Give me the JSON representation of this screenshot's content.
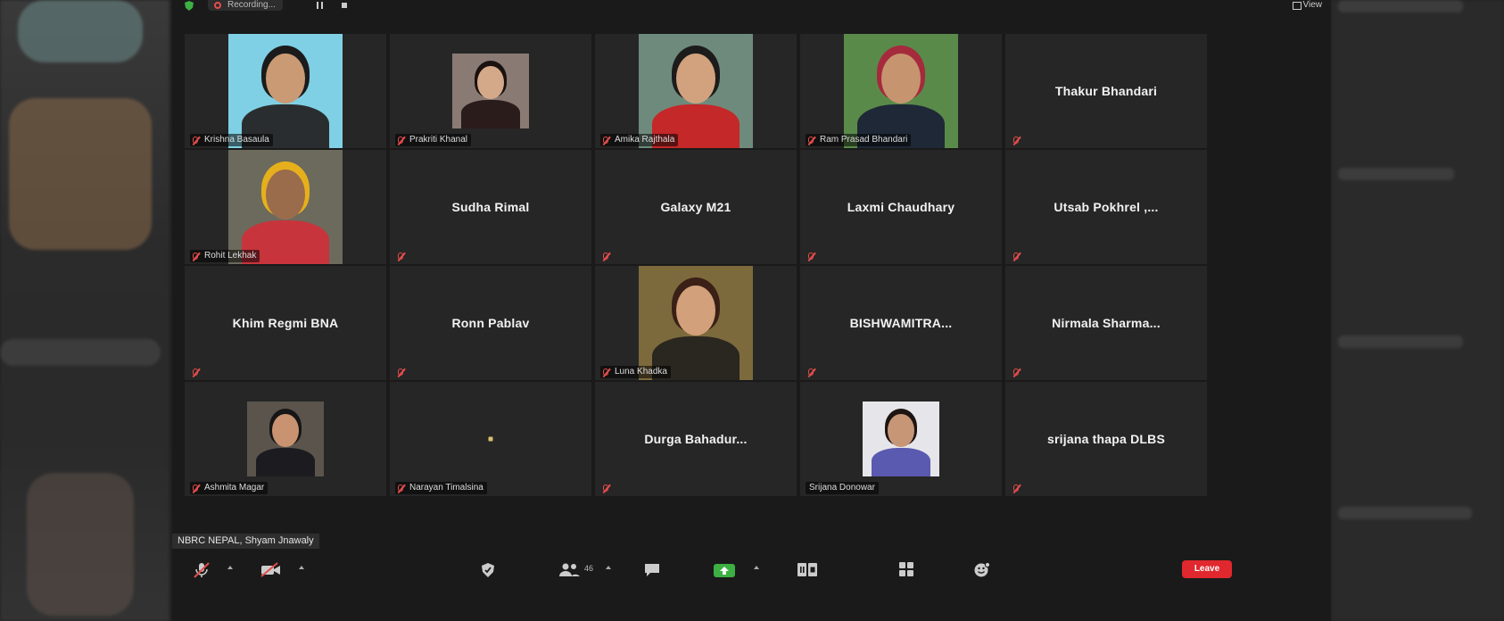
{
  "topbar": {
    "recording_label": "Recording...",
    "view_label": "View"
  },
  "tiles": [
    {
      "name": "Krishna Basaula",
      "display": "video",
      "muted": true,
      "photo_bg": "#7fd0e4",
      "skin": "#c99a74",
      "hair": "#1b1b1b",
      "cloth": "#2a2d2f"
    },
    {
      "name": "Prakriti Khanal",
      "display": "video",
      "muted": true,
      "photo_bg": "#8a7a74",
      "skin": "#d4a98a",
      "hair": "#1a1210",
      "cloth": "#2a1c1a"
    },
    {
      "name": "Amika Rajthala",
      "display": "video",
      "muted": true,
      "photo_bg": "#6e8a7c",
      "skin": "#d2a27e",
      "hair": "#1c1c1c",
      "cloth": "#c42828"
    },
    {
      "name": "Ram Prasad Bhandari",
      "display": "video",
      "muted": true,
      "photo_bg": "#5a8a4a",
      "skin": "#c79470",
      "hair": "#a42a3c",
      "cloth": "#1e2836"
    },
    {
      "name": "Thakur Bhandari",
      "display": "name",
      "muted": true
    },
    {
      "name": "Rohit Lekhak",
      "display": "video",
      "muted": true,
      "photo_bg": "#6c6a5c",
      "skin": "#9a6c4c",
      "hair": "#e6b01c",
      "cloth": "#c8343c"
    },
    {
      "name": "Sudha Rimal",
      "display": "name",
      "muted": true
    },
    {
      "name": "Galaxy M21",
      "display": "name",
      "muted": true
    },
    {
      "name": "Laxmi Chaudhary",
      "display": "name",
      "muted": true
    },
    {
      "name": "Utsab Pokhrel ,...",
      "display": "name",
      "muted": true
    },
    {
      "name": "Khim Regmi BNA",
      "display": "name",
      "muted": true
    },
    {
      "name": "Ronn Pablav",
      "display": "name",
      "muted": true
    },
    {
      "name": "Luna Khadka",
      "display": "video",
      "muted": true,
      "photo_bg": "#7c6a3c",
      "skin": "#d2a07a",
      "hair": "#3a2016",
      "cloth": "#2a2620"
    },
    {
      "name": "BISHWAMITRA...",
      "display": "name",
      "muted": true
    },
    {
      "name": "Nirmala Sharma...",
      "display": "name",
      "muted": true
    },
    {
      "name": "Ashmita Magar",
      "display": "video",
      "muted": true,
      "photo_bg": "#5a544c",
      "skin": "#c99270",
      "hair": "#161616",
      "cloth": "#1c1c20"
    },
    {
      "name": "Narayan Timalsina",
      "display": "dot",
      "muted": true
    },
    {
      "name": "Durga  Bahadur...",
      "display": "name",
      "muted": true
    },
    {
      "name": "Srijana Donowar",
      "display": "video",
      "muted": false,
      "photo_bg": "#e6e6ea",
      "skin": "#c79676",
      "hair": "#1e1412",
      "cloth": "#5a5ab0"
    },
    {
      "name": "srijana thapa DLBS",
      "display": "name",
      "muted": true
    }
  ],
  "speaker_label": "NBRC NEPAL, Shyam Jnawaly",
  "toolbar": {
    "participants_count": "46",
    "leave_label": "Leave"
  },
  "colors": {
    "muted_red": "#e64c4c",
    "leave_red": "#e0282e",
    "share_green": "#3cb043",
    "tile_bg": "#262626"
  }
}
